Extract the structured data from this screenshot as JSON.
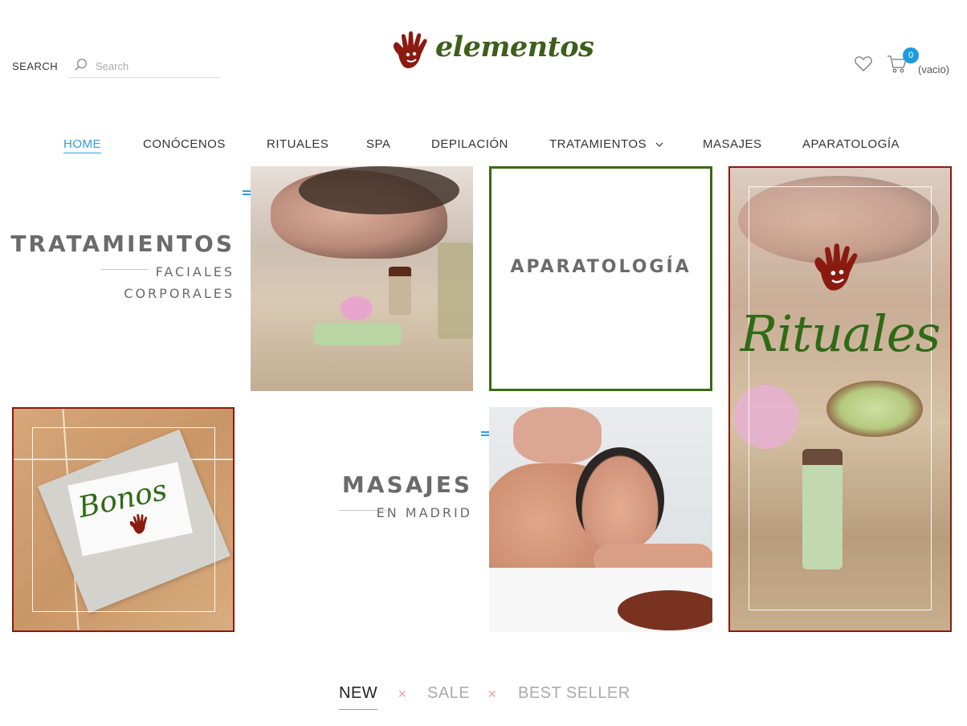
{
  "header": {
    "search_label": "SEARCH",
    "search_placeholder": "Search",
    "logo_text": "elementos",
    "cart_count": "0",
    "cart_status": "(vacio)"
  },
  "nav": {
    "items": [
      {
        "label": "HOME",
        "active": true
      },
      {
        "label": "CONÓCENOS"
      },
      {
        "label": "RITUALES"
      },
      {
        "label": "SPA"
      },
      {
        "label": "DEPILACIÓN"
      },
      {
        "label": "TRATAMIENTOS",
        "has_dropdown": true
      },
      {
        "label": "MASAJES"
      },
      {
        "label": "APARATOLOGÍA"
      }
    ]
  },
  "tiles": {
    "tratamientos": {
      "title": "TRATAMIENTOS",
      "line1": "FACIALES",
      "line2": "CORPORALES"
    },
    "aparatologia": {
      "title": "APARATOLOGÍA"
    },
    "rituales": {
      "script_text": "Rituales"
    },
    "bonos": {
      "script_text": "Bonos"
    },
    "masajes": {
      "title": "MASAJES",
      "subtitle": "EN MADRID"
    }
  },
  "product_tabs": [
    "NEW",
    "SALE",
    "BEST SELLER"
  ],
  "colors": {
    "accent": "#2e9fe0",
    "brand_green": "#3c5f1a",
    "brand_red": "#8b1a10",
    "tile_text": "#6b6b6b"
  }
}
